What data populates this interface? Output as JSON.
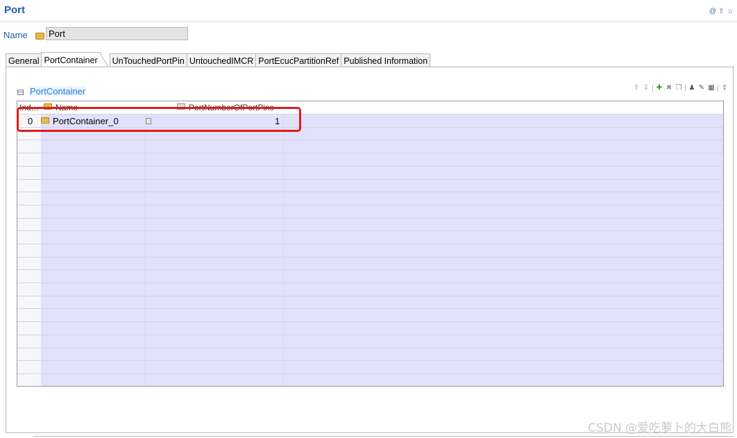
{
  "header": {
    "title": "Port"
  },
  "name_row": {
    "label": "Name",
    "value": "Port"
  },
  "tabs": [
    {
      "label": "General"
    },
    {
      "label": "PortContainer"
    },
    {
      "label": "UnTouchedPortPin"
    },
    {
      "label": "UntouchedIMCR"
    },
    {
      "label": "PortEcucPartitionRef"
    },
    {
      "label": "Published Information"
    }
  ],
  "active_tab": "PortContainer",
  "section": {
    "title": "PortContainer"
  },
  "table": {
    "columns": [
      {
        "label": "Ind…"
      },
      {
        "label": "Name"
      },
      {
        "label": "PortNumberOfPortPins"
      }
    ],
    "rows": [
      {
        "index": "0",
        "name": "PortContainer_0",
        "pins": "1"
      }
    ]
  },
  "watermark": "CSDN @爱吃萝卜的大白熊",
  "colors": {
    "accent": "#1f5fa8",
    "row_bg": "#e1e1fb",
    "highlight": "#e01b1b"
  }
}
